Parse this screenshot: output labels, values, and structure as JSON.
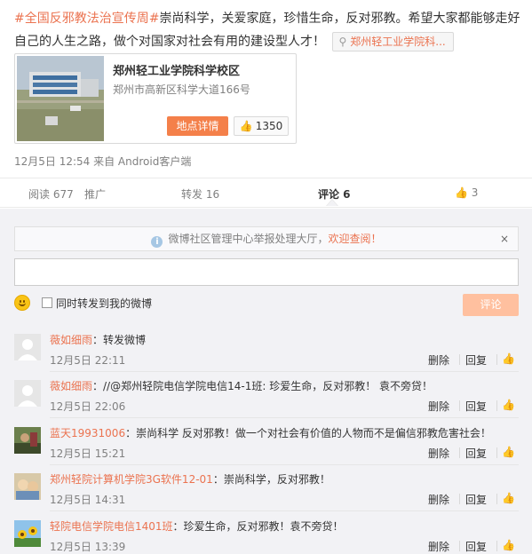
{
  "post": {
    "topic": "#全国反邪教法治宣传周#",
    "body": "崇尚科学，关爱家庭，珍惜生命，反对邪教。希望大家都能够走好自己的人生之路，做个对国家对社会有用的建设型人才！",
    "location_tag": "郑州轻工业学院科...",
    "location_icon": "pin-icon"
  },
  "place_card": {
    "title": "郑州轻工业学院科学校区",
    "address": "郑州市高新区科学大道166号",
    "detail_button": "地点详情",
    "like_count": "1350"
  },
  "meta": {
    "timestamp": "12月5日 12:54 来自 Android客户端"
  },
  "actions": {
    "read": "阅读 677",
    "promote": "推广",
    "repost": "转发 16",
    "comment": "评论 6",
    "like": "3"
  },
  "comment_box": {
    "notice_text": "微博社区管理中心举报处理大厅，",
    "notice_link": "欢迎查阅！",
    "notice_close": "×",
    "input_value": "",
    "also_repost_label": "同时转发到我的微博",
    "submit_label": "评论"
  },
  "comments": [
    {
      "user": "薇如细雨",
      "text": "：转发微博",
      "time": "12月5日 22:11",
      "delete": "删除",
      "reply": "回复",
      "avatar": "default-avatar"
    },
    {
      "user": "薇如细雨",
      "text": "：//@郑州轻院电信学院电信14-1班: 珍爱生命，反对邪教！ 袁不旁贷！",
      "time": "12月5日 22:06",
      "delete": "删除",
      "reply": "回复",
      "avatar": "default-avatar"
    },
    {
      "user": "蓝天19931006",
      "text": "：崇尚科学 反对邪教！做一个对社会有价值的人物而不是偏信邪教危害社会！",
      "time": "12月5日 15:21",
      "delete": "删除",
      "reply": "回复",
      "avatar": "photo-avatar"
    },
    {
      "user": "郑州轻院计算机学院3G软件12-01",
      "text": "：崇尚科学，反对邪教！",
      "time": "12月5日 14:31",
      "delete": "删除",
      "reply": "回复",
      "avatar": "photo-avatar"
    },
    {
      "user": "轻院电信学院电信1401班",
      "text": "：珍爱生命，反对邪教！袁不旁贷！",
      "time": "12月5日 13:39",
      "delete": "删除",
      "reply": "回复",
      "avatar": "sunflower-avatar"
    }
  ],
  "colors": {
    "accent": "#eb7350",
    "submit_disabled": "#ffc09f",
    "detail_button": "#f4804a",
    "comment_bg": "#f2f2f5"
  }
}
